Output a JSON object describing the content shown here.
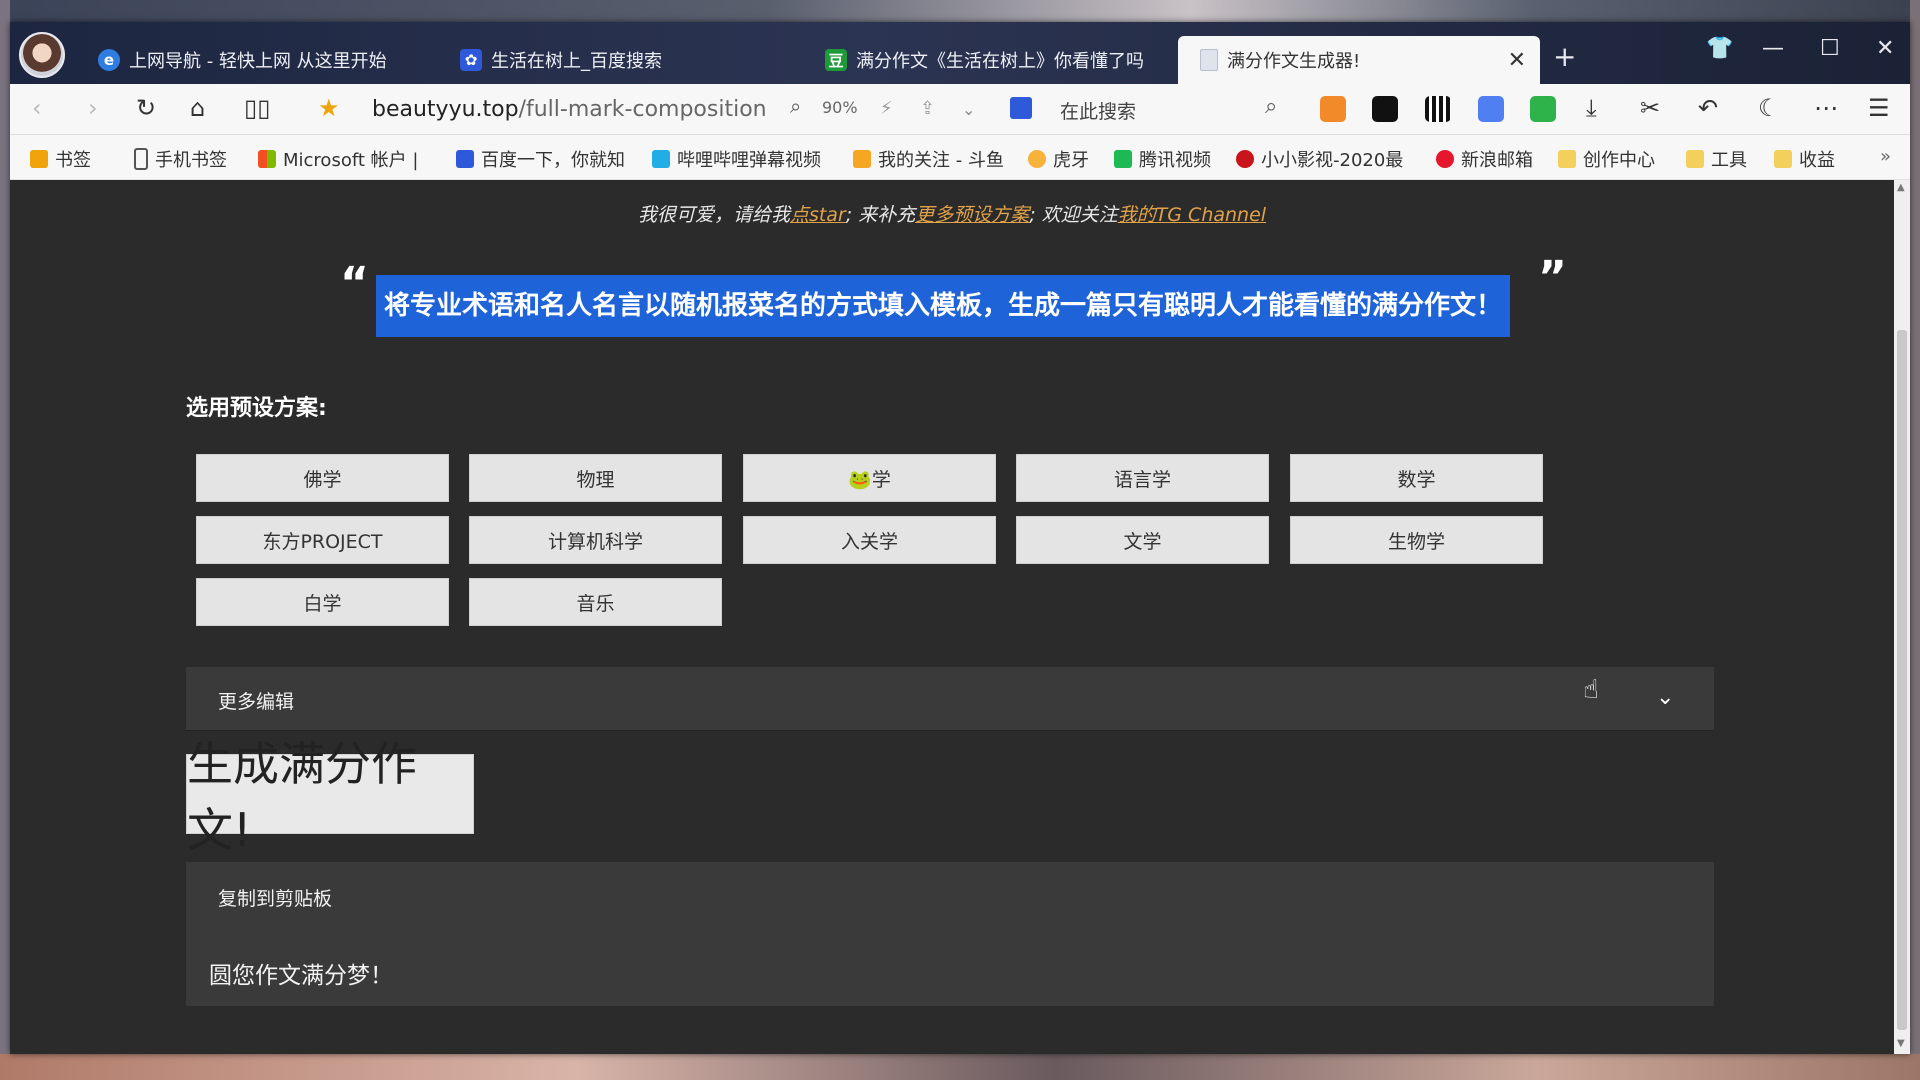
{
  "browser": {
    "tabs": [
      {
        "label": "上网导航 - 轻快上网 从这里开始",
        "icon": "ie-icon"
      },
      {
        "label": "生活在树上_百度搜索",
        "icon": "baidu-icon"
      },
      {
        "label": "满分作文《生活在树上》你看懂了吗",
        "icon": "douban-icon"
      },
      {
        "label": "满分作文生成器!",
        "icon": "page-icon"
      }
    ],
    "url_host": "beautyyu.top",
    "url_path": "/full-mark-composition-g",
    "zoom": "90%",
    "search_placeholder": "在此搜索",
    "bookmarks": [
      "书签",
      "手机书签",
      "Microsoft 帐户 |",
      "百度一下，你就知",
      "哔哩哔哩弹幕视频",
      "我的关注 - 斗鱼",
      "虎牙",
      "腾讯视频",
      "小小影视-2020最",
      "新浪邮箱",
      "创作中心",
      "工具",
      "收益"
    ]
  },
  "page": {
    "subtitle_pre": "我很可爱，请给我",
    "subtitle_link1": "点star",
    "subtitle_mid": "; 来补充",
    "subtitle_link2": "更多预设方案",
    "subtitle_mid2": "; 欢迎关注",
    "subtitle_link3": "我的TG Channel",
    "quote_open": "“",
    "quote_close": "”",
    "tagline": "将专业术语和名人名言以随机报菜名的方式填入模板，生成一篇只有聪明人才能看懂的满分作文！",
    "presets_title": "选用预设方案:",
    "presets": [
      "佛学",
      "物理",
      "🐸学",
      "语言学",
      "数学",
      "东方PROJECT",
      "计算机科学",
      "入关学",
      "文学",
      "生物学",
      "白学",
      "音乐"
    ],
    "more_edit": "更多编辑",
    "generate_button": "生成满分作文!",
    "copy_label": "复制到剪贴板",
    "output_text": "圆您作文满分梦！"
  },
  "colors": {
    "page_bg": "#2b2b2b",
    "highlight": "#1e63d8",
    "link": "#e0a24a",
    "button_bg": "#e4e4e4",
    "panel_bg": "#3a3a3a"
  }
}
